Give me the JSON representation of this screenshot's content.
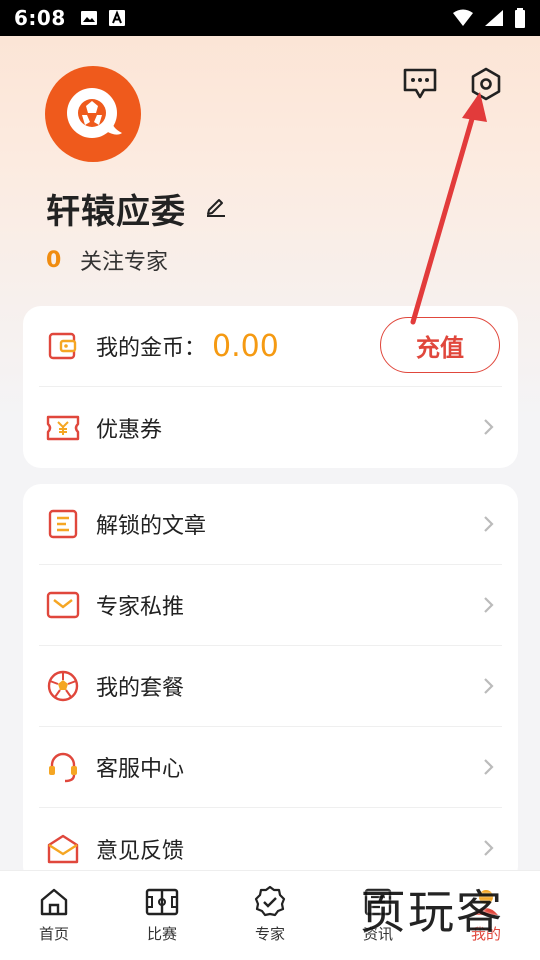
{
  "status_bar": {
    "time": "6:08"
  },
  "profile": {
    "name": "轩辕应委",
    "follow_count": "0",
    "follow_label": "关注专家"
  },
  "wallet": {
    "coins_label": "我的金币：",
    "coins_value": "0.00",
    "recharge_label": "充值",
    "coupon_label": "优惠券"
  },
  "menu": [
    {
      "label": "解锁的文章",
      "icon": "article-icon"
    },
    {
      "label": "专家私推",
      "icon": "mail-icon"
    },
    {
      "label": "我的套餐",
      "icon": "football-icon"
    },
    {
      "label": "客服中心",
      "icon": "headset-icon"
    },
    {
      "label": "意见反馈",
      "icon": "feedback-envelope-icon"
    }
  ],
  "bottom_nav": [
    {
      "label": "首页",
      "icon": "home-icon"
    },
    {
      "label": "比赛",
      "icon": "match-field-icon"
    },
    {
      "label": "专家",
      "icon": "expert-badge-icon"
    },
    {
      "label": "资讯",
      "icon": "news-icon"
    },
    {
      "label": "我的",
      "icon": "profile-icon",
      "active": true
    }
  ],
  "watermark": "页玩客",
  "colors": {
    "accent": "#e0473c",
    "coin": "#f59a12",
    "avatar_bg": "#ef5a1c",
    "annotation_arrow": "#e23b3b"
  }
}
